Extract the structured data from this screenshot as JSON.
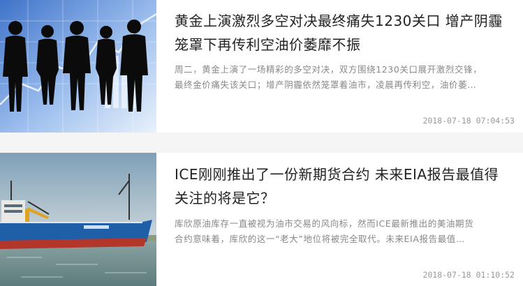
{
  "articles": [
    {
      "title": "黄金上演激烈多空对决最终痛失1230关口 增产阴霾笼罩下再传利空油价萎靡不振",
      "summary": "周二，黄金上演了一场精彩的多空对决，双方围绕1230关口展开激烈交锋，\n最终金价痛失该关口；增产阴霾依然笼罩着油市，凌晨再传利空，油价萎…",
      "time": "2018-07-18 07:04:53",
      "image_icon": "business-silhouettes-image"
    },
    {
      "title": "ICE刚刚推出了一份新期货合约 未来EIA报告最值得关注的将是它？",
      "summary": "库欣原油库存一直被视为油市交易的风向标，然而ICE最新推出的美油期货\n合约意味着，库欣的这一“老大”地位将被完全取代。未来EIA报告最值…",
      "time": "2018-07-18 01:10:52",
      "image_icon": "cargo-ship-image"
    }
  ],
  "colors": {
    "title": "#222222",
    "summary": "#888888",
    "time": "#999999",
    "divider": "#f5f5f5"
  }
}
